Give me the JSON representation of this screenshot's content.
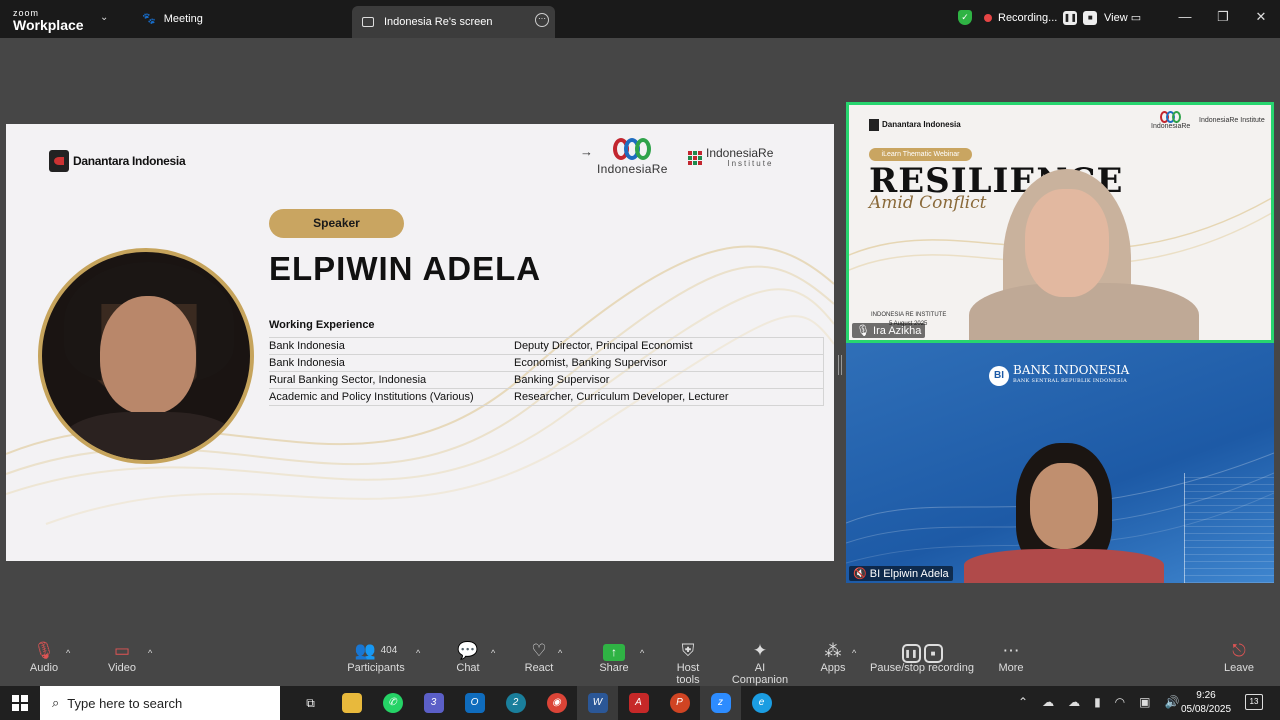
{
  "titlebar": {
    "brand_top": "zoom",
    "brand_bottom": "Workplace",
    "meeting_label": "Meeting",
    "tab_label": "Indonesia Re's screen",
    "recording_label": "Recording...",
    "view_label": "View"
  },
  "slide": {
    "danantara_logo": "Danantara Indonesia",
    "indonesiare_logo": "IndonesiaRe",
    "institute_logo_1": "IndonesiaRe",
    "institute_logo_2": "Institute",
    "speaker_pill": "Speaker",
    "speaker_name": "ELPIWIN ADELA",
    "we_title": "Working Experience",
    "experience": [
      {
        "org": "Bank Indonesia",
        "role": "Deputy Director, Principal Economist"
      },
      {
        "org": "Bank Indonesia",
        "role": "Economist, Banking Supervisor"
      },
      {
        "org": "Rural Banking Sector, Indonesia",
        "role": "Banking Supervisor"
      },
      {
        "org": "Academic and Policy Institutions (Various)",
        "role": "Researcher, Curriculum Developer, Lecturer"
      }
    ],
    "accent_color": "#c9a561"
  },
  "video1": {
    "pill": "iLearn Thematic Webinar",
    "big": "RESILIENCE",
    "sub": "Amid Conflict",
    "inst": "INDONESIA RE INSTITUTE",
    "date": "5 August 2025",
    "logo_a": "Danantara Indonesia",
    "logo_b": "IndonesiaRe",
    "logo_c": "IndonesiaRe Institute",
    "name": "Ira Azikha",
    "border_color": "#27d56f"
  },
  "video2": {
    "bi_title": "BANK INDONESIA",
    "bi_sub": "BANK SENTRAL REPUBLIK INDONESIA",
    "name": "BI Elpiwin Adela"
  },
  "toolbar": {
    "audio": "Audio",
    "video": "Video",
    "participants": "Participants",
    "participants_count": "404",
    "chat": "Chat",
    "react": "React",
    "share": "Share",
    "host_tools": "Host tools",
    "ai_companion": "AI Companion",
    "apps": "Apps",
    "pause_stop": "Pause/stop recording",
    "more": "More",
    "leave": "Leave"
  },
  "taskbar": {
    "search_placeholder": "Type here to search",
    "time": "9:26",
    "date": "05/08/2025",
    "notif_count": "13",
    "teams_badge": "3",
    "edge_badge": "2"
  }
}
